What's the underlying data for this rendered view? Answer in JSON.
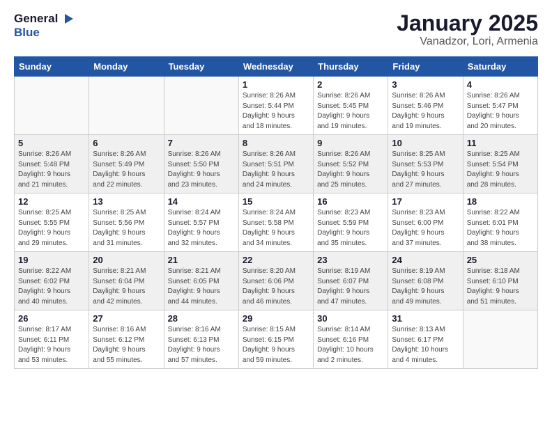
{
  "logo": {
    "text_general": "General",
    "text_blue": "Blue"
  },
  "title": "January 2025",
  "subtitle": "Vanadzor, Lori, Armenia",
  "days_of_week": [
    "Sunday",
    "Monday",
    "Tuesday",
    "Wednesday",
    "Thursday",
    "Friday",
    "Saturday"
  ],
  "weeks": [
    {
      "shaded": false,
      "days": [
        {
          "num": "",
          "info": ""
        },
        {
          "num": "",
          "info": ""
        },
        {
          "num": "",
          "info": ""
        },
        {
          "num": "1",
          "info": "Sunrise: 8:26 AM\nSunset: 5:44 PM\nDaylight: 9 hours\nand 18 minutes."
        },
        {
          "num": "2",
          "info": "Sunrise: 8:26 AM\nSunset: 5:45 PM\nDaylight: 9 hours\nand 19 minutes."
        },
        {
          "num": "3",
          "info": "Sunrise: 8:26 AM\nSunset: 5:46 PM\nDaylight: 9 hours\nand 19 minutes."
        },
        {
          "num": "4",
          "info": "Sunrise: 8:26 AM\nSunset: 5:47 PM\nDaylight: 9 hours\nand 20 minutes."
        }
      ]
    },
    {
      "shaded": true,
      "days": [
        {
          "num": "5",
          "info": "Sunrise: 8:26 AM\nSunset: 5:48 PM\nDaylight: 9 hours\nand 21 minutes."
        },
        {
          "num": "6",
          "info": "Sunrise: 8:26 AM\nSunset: 5:49 PM\nDaylight: 9 hours\nand 22 minutes."
        },
        {
          "num": "7",
          "info": "Sunrise: 8:26 AM\nSunset: 5:50 PM\nDaylight: 9 hours\nand 23 minutes."
        },
        {
          "num": "8",
          "info": "Sunrise: 8:26 AM\nSunset: 5:51 PM\nDaylight: 9 hours\nand 24 minutes."
        },
        {
          "num": "9",
          "info": "Sunrise: 8:26 AM\nSunset: 5:52 PM\nDaylight: 9 hours\nand 25 minutes."
        },
        {
          "num": "10",
          "info": "Sunrise: 8:25 AM\nSunset: 5:53 PM\nDaylight: 9 hours\nand 27 minutes."
        },
        {
          "num": "11",
          "info": "Sunrise: 8:25 AM\nSunset: 5:54 PM\nDaylight: 9 hours\nand 28 minutes."
        }
      ]
    },
    {
      "shaded": false,
      "days": [
        {
          "num": "12",
          "info": "Sunrise: 8:25 AM\nSunset: 5:55 PM\nDaylight: 9 hours\nand 29 minutes."
        },
        {
          "num": "13",
          "info": "Sunrise: 8:25 AM\nSunset: 5:56 PM\nDaylight: 9 hours\nand 31 minutes."
        },
        {
          "num": "14",
          "info": "Sunrise: 8:24 AM\nSunset: 5:57 PM\nDaylight: 9 hours\nand 32 minutes."
        },
        {
          "num": "15",
          "info": "Sunrise: 8:24 AM\nSunset: 5:58 PM\nDaylight: 9 hours\nand 34 minutes."
        },
        {
          "num": "16",
          "info": "Sunrise: 8:23 AM\nSunset: 5:59 PM\nDaylight: 9 hours\nand 35 minutes."
        },
        {
          "num": "17",
          "info": "Sunrise: 8:23 AM\nSunset: 6:00 PM\nDaylight: 9 hours\nand 37 minutes."
        },
        {
          "num": "18",
          "info": "Sunrise: 8:22 AM\nSunset: 6:01 PM\nDaylight: 9 hours\nand 38 minutes."
        }
      ]
    },
    {
      "shaded": true,
      "days": [
        {
          "num": "19",
          "info": "Sunrise: 8:22 AM\nSunset: 6:02 PM\nDaylight: 9 hours\nand 40 minutes."
        },
        {
          "num": "20",
          "info": "Sunrise: 8:21 AM\nSunset: 6:04 PM\nDaylight: 9 hours\nand 42 minutes."
        },
        {
          "num": "21",
          "info": "Sunrise: 8:21 AM\nSunset: 6:05 PM\nDaylight: 9 hours\nand 44 minutes."
        },
        {
          "num": "22",
          "info": "Sunrise: 8:20 AM\nSunset: 6:06 PM\nDaylight: 9 hours\nand 46 minutes."
        },
        {
          "num": "23",
          "info": "Sunrise: 8:19 AM\nSunset: 6:07 PM\nDaylight: 9 hours\nand 47 minutes."
        },
        {
          "num": "24",
          "info": "Sunrise: 8:19 AM\nSunset: 6:08 PM\nDaylight: 9 hours\nand 49 minutes."
        },
        {
          "num": "25",
          "info": "Sunrise: 8:18 AM\nSunset: 6:10 PM\nDaylight: 9 hours\nand 51 minutes."
        }
      ]
    },
    {
      "shaded": false,
      "days": [
        {
          "num": "26",
          "info": "Sunrise: 8:17 AM\nSunset: 6:11 PM\nDaylight: 9 hours\nand 53 minutes."
        },
        {
          "num": "27",
          "info": "Sunrise: 8:16 AM\nSunset: 6:12 PM\nDaylight: 9 hours\nand 55 minutes."
        },
        {
          "num": "28",
          "info": "Sunrise: 8:16 AM\nSunset: 6:13 PM\nDaylight: 9 hours\nand 57 minutes."
        },
        {
          "num": "29",
          "info": "Sunrise: 8:15 AM\nSunset: 6:15 PM\nDaylight: 9 hours\nand 59 minutes."
        },
        {
          "num": "30",
          "info": "Sunrise: 8:14 AM\nSunset: 6:16 PM\nDaylight: 10 hours\nand 2 minutes."
        },
        {
          "num": "31",
          "info": "Sunrise: 8:13 AM\nSunset: 6:17 PM\nDaylight: 10 hours\nand 4 minutes."
        },
        {
          "num": "",
          "info": ""
        }
      ]
    }
  ]
}
